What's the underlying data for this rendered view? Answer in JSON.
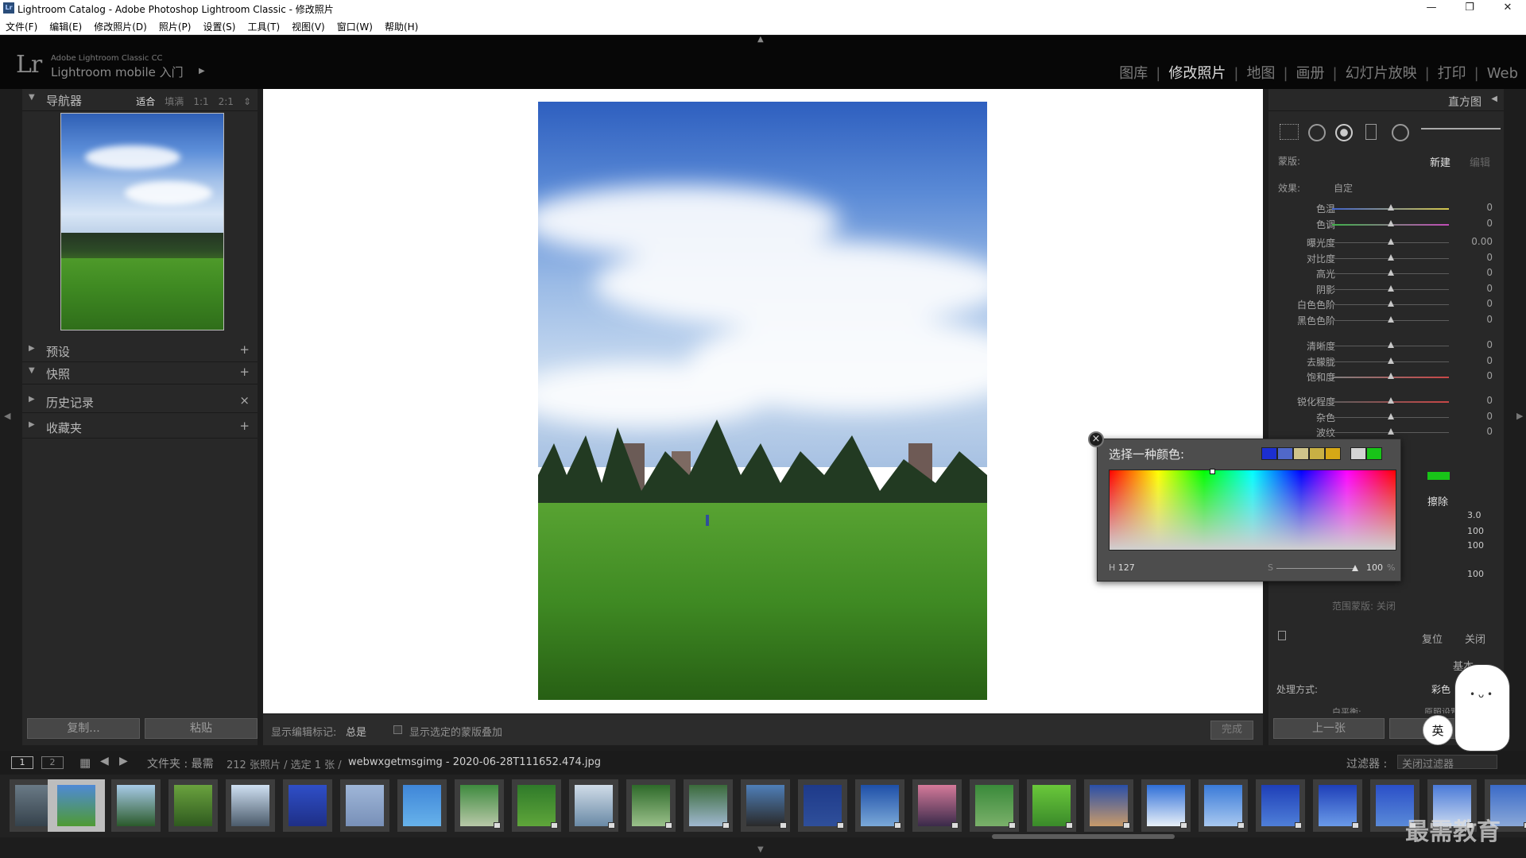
{
  "window": {
    "title": "Lightroom Catalog - Adobe Photoshop Lightroom Classic - 修改照片",
    "controls": {
      "minimize": "—",
      "maximize": "❐",
      "close": "✕"
    }
  },
  "menubar": [
    "文件(F)",
    "编辑(E)",
    "修改照片(D)",
    "照片(P)",
    "设置(S)",
    "工具(T)",
    "视图(V)",
    "窗口(W)",
    "帮助(H)"
  ],
  "identity": {
    "logo": "Lr",
    "product": "Adobe Lightroom Classic CC",
    "mobile": "Lightroom mobile 入门"
  },
  "modules": [
    "图库",
    "修改照片",
    "地图",
    "画册",
    "幻灯片放映",
    "打印",
    "Web"
  ],
  "left_panel": {
    "navigator": {
      "label": "导航器",
      "zoom": [
        "适合",
        "填满",
        "1:1",
        "2:1"
      ]
    },
    "sections": [
      {
        "label": "预设",
        "action": "+"
      },
      {
        "label": "快照",
        "action": "+"
      },
      {
        "label": "历史记录",
        "action": "×"
      },
      {
        "label": "收藏夹",
        "action": "+"
      }
    ],
    "copy_button": "复制...",
    "paste_button": "粘贴"
  },
  "toolbar": {
    "show_label": "显示编辑标记:",
    "show_value": "总是",
    "overlay_label": "显示选定的蒙版叠加",
    "done_button": "完成"
  },
  "right_panel": {
    "histogram_label": "直方图",
    "mask_label": "蒙版:",
    "mask_new": "新建",
    "mask_edit": "编辑",
    "effect_label": "效果:",
    "effect_value": "自定",
    "group1": [
      {
        "label": "色温",
        "value": "0"
      },
      {
        "label": "色调",
        "value": "0"
      }
    ],
    "group2": [
      {
        "label": "曝光度",
        "value": "0.00"
      },
      {
        "label": "对比度",
        "value": "0"
      },
      {
        "label": "高光",
        "value": "0"
      },
      {
        "label": "阴影",
        "value": "0"
      },
      {
        "label": "白色色阶",
        "value": "0"
      },
      {
        "label": "黑色色阶",
        "value": "0"
      }
    ],
    "group3": [
      {
        "label": "清晰度",
        "value": "0"
      },
      {
        "label": "去朦胧",
        "value": "0"
      },
      {
        "label": "饱和度",
        "value": "0"
      }
    ],
    "group4": [
      {
        "label": "锐化程度",
        "value": "0"
      },
      {
        "label": "杂色",
        "value": "0"
      },
      {
        "label": "波纹",
        "value": "0"
      }
    ],
    "erase_label": "擦除",
    "brush_values": [
      "3.0",
      "100",
      "100",
      "100"
    ],
    "range_mask": "范围蒙版:  关闭",
    "reset_button": "复位",
    "close_button": "关闭",
    "basic_label": "基本",
    "treatment_label": "处理方式:",
    "treatment_value": "彩色",
    "wb_label": "白平衡:",
    "wb_value": "原照设置",
    "prev_button": "上一张"
  },
  "color_picker": {
    "title": "选择一种颜色:",
    "close": "×",
    "swatches": [
      "#1c2fd1",
      "#5068c8",
      "#cfc48a",
      "#c8b044",
      "#d6a816",
      "#d3d3d3",
      "#18c418"
    ],
    "h_label": "H",
    "h_value": "127",
    "s_label": "S",
    "s_value": "100",
    "s_unit": "%"
  },
  "filmstrip_bar": {
    "pages": [
      "1",
      "2"
    ],
    "path": "文件夹 : 最需",
    "count": "212 张照片 / 选定 1 张 /",
    "filename": "webwxgetmsgimg - 2020-06-28T111652.474.jpg",
    "filter_label": "过滤器 :",
    "filter_value": "关闭过滤器"
  },
  "overlays": {
    "ime_badge": "英",
    "watermark": "最需教育"
  },
  "colors": {
    "accent_green": "#18c418",
    "panel": "#282828",
    "background": "#1d1d1d"
  }
}
